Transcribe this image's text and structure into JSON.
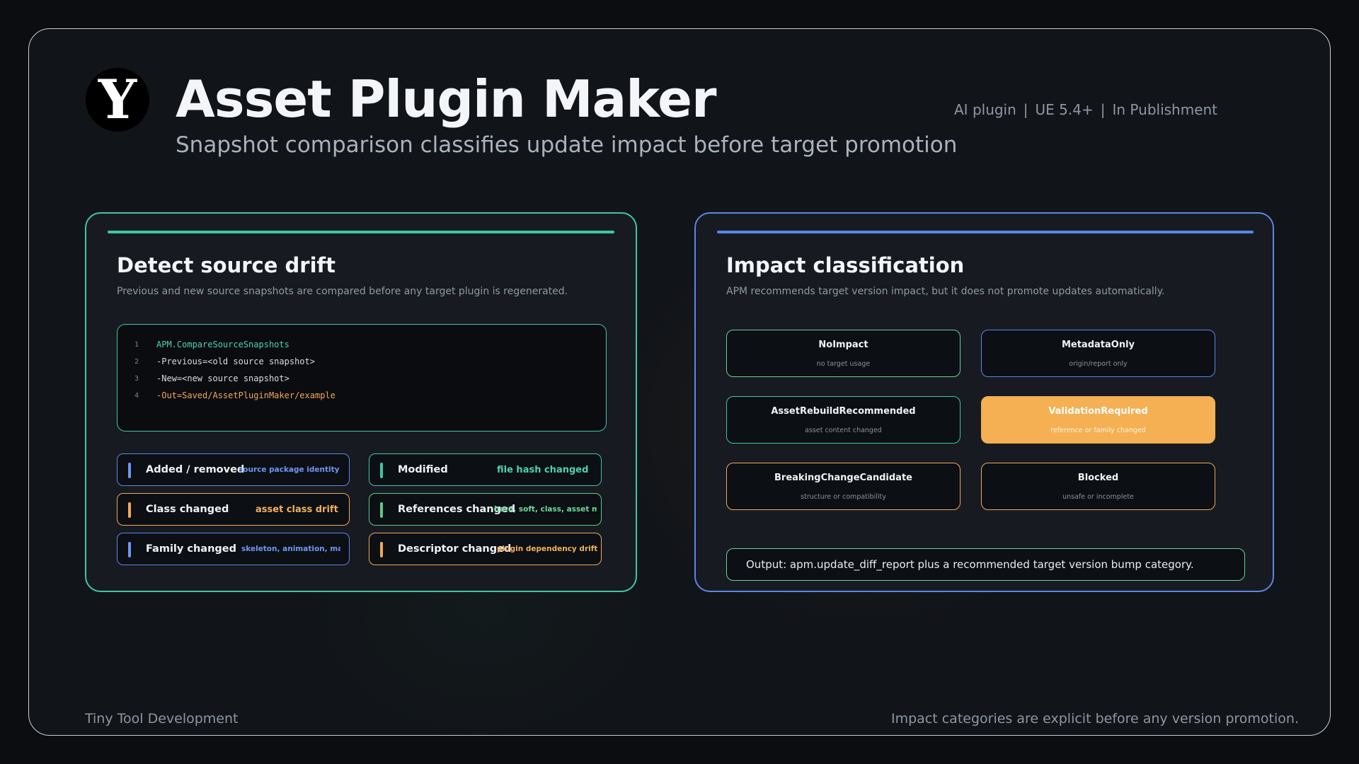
{
  "header": {
    "logo_letter": "Y",
    "title": "Asset Plugin Maker",
    "subtitle": "Snapshot comparison classifies update impact before target promotion",
    "meta": [
      "AI plugin",
      "UE 5.4+",
      "In Publishment"
    ],
    "meta_sep": "|"
  },
  "left_panel": {
    "title": "Detect source drift",
    "description": "Previous and new source snapshots are compared before any target plugin is regenerated.",
    "code_lines": [
      {
        "num": "1",
        "text": "APM.CompareSourceSnapshots"
      },
      {
        "num": "2",
        "text": "-Previous=<old source snapshot>"
      },
      {
        "num": "3",
        "text": "-New=<new source snapshot>"
      },
      {
        "num": "4",
        "text": "-Out=Saved/AssetPluginMaker/example"
      }
    ],
    "chips": [
      {
        "label": "Added / removed",
        "tag": "source package identity"
      },
      {
        "label": "Class changed",
        "tag": "asset class drift"
      },
      {
        "label": "Family changed",
        "tag": "skeleton, animation, ma..."
      },
      {
        "label": "Modified",
        "tag": "file hash changed"
      },
      {
        "label": "References changed",
        "tag": "hard, soft, class, asset m..."
      },
      {
        "label": "Descriptor changed",
        "tag": "plugin dependency drift"
      }
    ]
  },
  "right_panel": {
    "title": "Impact classification",
    "description": "APM recommends target version impact, but it does not promote updates automatically.",
    "categories": [
      {
        "name": "NoImpact",
        "sub": "no target usage"
      },
      {
        "name": "MetadataOnly",
        "sub": "origin/report only"
      },
      {
        "name": "AssetRebuildRecommended",
        "sub": "asset content changed"
      },
      {
        "name": "ValidationRequired",
        "sub": "reference or family changed"
      },
      {
        "name": "BreakingChangeCandidate",
        "sub": "structure or compatibility"
      },
      {
        "name": "Blocked",
        "sub": "unsafe or incomplete"
      }
    ],
    "output": "Output: apm.update_diff_report plus a recommended target version bump category."
  },
  "footer": {
    "left": "Tiny Tool Development",
    "right": "Impact categories are explicit before any version promotion."
  },
  "colors": {
    "teal_accent": "#3ec6a6",
    "blue_accent": "#5b86e8",
    "orange_accent": "#f0a85a",
    "green_accent": "#6ad197",
    "highlight_fill": "#f4b053"
  }
}
